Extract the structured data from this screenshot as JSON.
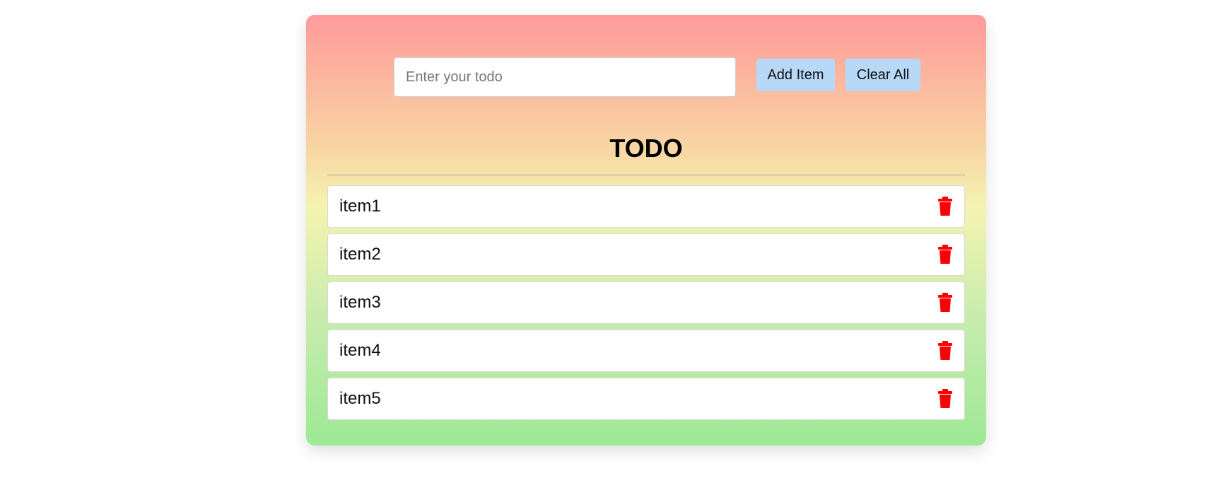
{
  "input": {
    "placeholder": "Enter your todo",
    "value": ""
  },
  "buttons": {
    "add_label": "Add Item",
    "clear_label": "Clear All"
  },
  "title": "TODO",
  "items": [
    {
      "label": "item1",
      "delete_icon": "trash-icon"
    },
    {
      "label": "item2",
      "delete_icon": "trash-icon"
    },
    {
      "label": "item3",
      "delete_icon": "trash-icon"
    },
    {
      "label": "item4",
      "delete_icon": "trash-icon"
    },
    {
      "label": "item5",
      "delete_icon": "trash-icon"
    }
  ],
  "colors": {
    "gradient_top": "#ff9a9a",
    "gradient_middle": "#f4f4b0",
    "gradient_bottom": "#9de995",
    "button_background": "#b8d8f8",
    "delete_icon": "#ff0000"
  }
}
